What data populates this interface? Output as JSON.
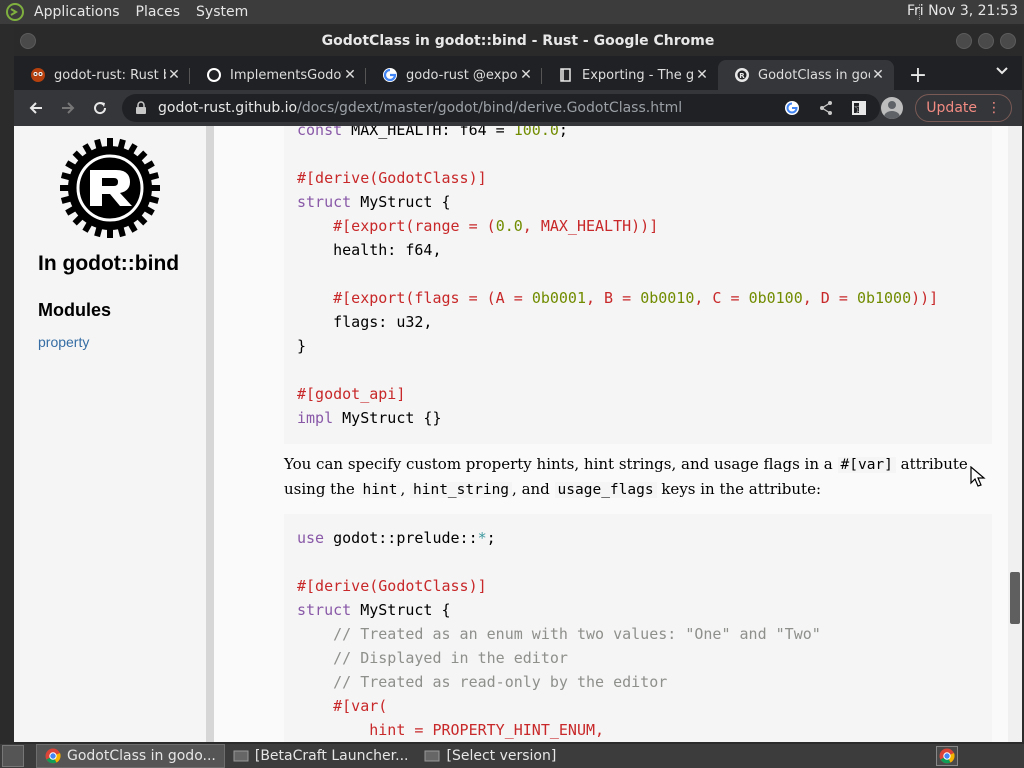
{
  "top_panel": {
    "menus": [
      "Applications",
      "Places",
      "System"
    ],
    "clock": "Fri Nov  3, 21:53"
  },
  "window": {
    "title": "GodotClass in godot::bind - Rust - Google Chrome"
  },
  "tabs": [
    {
      "label": "godot-rust: Rust bi",
      "icon": "godot-rust-icon"
    },
    {
      "label": "ImplementsGodotE",
      "icon": "github-icon"
    },
    {
      "label": "godo-rust @export",
      "icon": "google-icon"
    },
    {
      "label": "Exporting - The gd",
      "icon": "book-icon"
    },
    {
      "label": "GodotClass in godo",
      "icon": "rust-icon",
      "active": true
    }
  ],
  "toolbar": {
    "url_host": "godot-rust.github.io",
    "url_path": "/docs/gdext/master/godot/bind/derive.GodotClass.html",
    "update_label": "Update"
  },
  "sidebar": {
    "crate_title": "In godot::bind",
    "modules_title": "Modules",
    "module_link": "property"
  },
  "prose": {
    "p1_a": "You can specify custom property hints, hint strings, and usage flags in a ",
    "p1_code1": "#[var]",
    "p1_b": " attribute using the ",
    "p1_code2": "hint",
    "p1_c": ", ",
    "p1_code3": "hint_string",
    "p1_d": ", and ",
    "p1_code4": "usage_flags",
    "p1_e": " keys in the attribute:"
  },
  "taskbar": {
    "tasks": [
      "GodotClass in godo...",
      "[BetaCraft Launcher...",
      "[Select version]"
    ]
  },
  "colors": {
    "accent_link": "#356da4",
    "update_red": "#f28b82",
    "code_keyword": "#8959a8",
    "code_attribute": "#c82829",
    "code_number": "#718c00"
  }
}
